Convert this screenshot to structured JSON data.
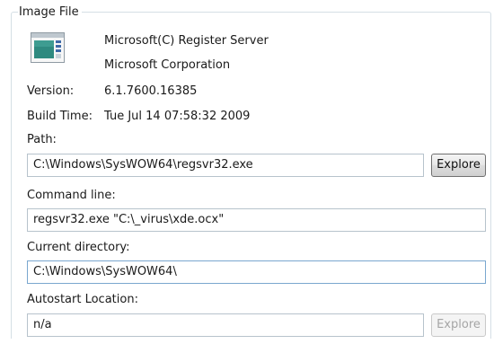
{
  "groupbox": {
    "title": "Image File"
  },
  "image": {
    "icon": "executable-window-icon",
    "description": "Microsoft(C) Register Server",
    "company": "Microsoft Corporation",
    "version_label": "Version:",
    "version_value": "6.1.7600.16385",
    "build_time_label": "Build Time:",
    "build_time_value": "Tue Jul 14 07:58:32 2009"
  },
  "path": {
    "label": "Path:",
    "value": "C:\\Windows\\SysWOW64\\regsvr32.exe",
    "explore_label": "Explore"
  },
  "command_line": {
    "label": "Command line:",
    "value": "regsvr32.exe  \"C:\\_virus\\xde.ocx\""
  },
  "current_directory": {
    "label": "Current directory:",
    "value": "C:\\Windows\\SysWOW64\\"
  },
  "autostart": {
    "label": "Autostart Location:",
    "value": "n/a",
    "explore_label": "Explore",
    "explore_enabled": false
  },
  "colors": {
    "border": "#d5dfe5",
    "field_border": "#b7c3cc",
    "focus_border": "#7aa7cf",
    "disabled_text": "#a5a5a5"
  }
}
